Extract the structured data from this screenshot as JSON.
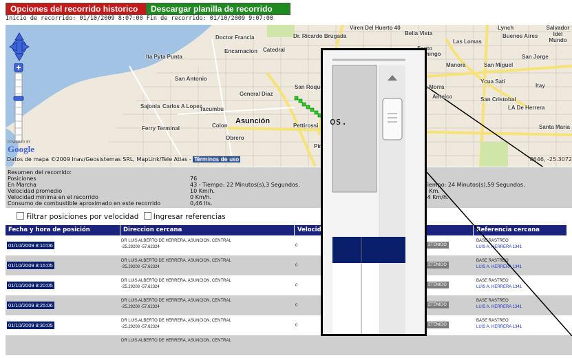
{
  "toolbar": {
    "history_options": "Opciones del recorrido historico",
    "download_sheet": "Descargar planilla de recorrido"
  },
  "period": "Inicio de recorrido: 01/10/2009 8:07:00 Fin de recorrido: 01/10/2009 9:07:00",
  "map": {
    "labels": [
      "Doctor Francia",
      "Dr. Ricardo Brugada",
      "Viren Del Huerto 40",
      "Bella Vista",
      "Lynch",
      "Salvador Idel Mundo",
      "Buenos Aires",
      "Las Lomas",
      "Encarnacion",
      "Catedral",
      "Ita Pyta Punta",
      "Manicoria",
      "Santo",
      "Domingo",
      "San Jorge",
      "Manora",
      "San Miguel",
      "San Antonio",
      "San Roque",
      "Ycua Sati",
      "Itay",
      "General Diaz",
      "lla Morra",
      "Antelco",
      "San Cristobal",
      "LA De Herrera",
      "Sajonia",
      "Carlos A Lopez",
      "Tacumbu",
      "Asunción",
      "Colon",
      "Pettirossi",
      "B. Ca",
      "Santa Maria",
      "Ferry Terminal",
      "Obrero",
      "Pin",
      "Mercado"
    ],
    "attribution": "Datos de mapa ©2009 Inav/Geosistemas SRL, MapLink/Tele Atlas -",
    "terms": "Términos de uso",
    "coord_readout": "8646, -25.3072",
    "google_powered": "POWERED BY",
    "google_logo": "Google"
  },
  "summary": {
    "heading": "Resumen del recorrido:",
    "rows": [
      {
        "label": "Posiciones",
        "value": "76",
        "value2": ""
      },
      {
        "label": "En Marcha",
        "value": "43 - Tiempo: 22 Minutos(s),3 Segundos.",
        "value2": "7 - Tiempo: 24 Minutos(s),59 Segundos."
      },
      {
        "label": "Velocidad promedio",
        "value": "10 Km/h.",
        "value2": "5,75 Km."
      },
      {
        "label": "Velocidad minima en el recorrido",
        "value": "0 Km/h.",
        "value2": "do 54 Km/h."
      },
      {
        "label": "Consumo de combustible aproximado en este recorrido",
        "value": "0,46 lts.",
        "value2": ""
      }
    ]
  },
  "filters": {
    "speed_filter": "Filtrar posiciones por velocidad",
    "references": "Ingresar referencias"
  },
  "table": {
    "columns": [
      "Fecha y hora de posición",
      "Direccion cercana",
      "Velocida",
      "",
      "Referencia cercana"
    ],
    "rows": [
      {
        "date": "01/10/2009 8:10:06",
        "addr1": "DR LUIS ALBERTO DE HERRERA, ASUNCION, CENTRAL",
        "addr2": "-25.29208 -57.62324",
        "speed": "0",
        "status": "ETENIDO",
        "ref1": "BASE RASTREO",
        "ref2": "LUIS A. HERRERA 1341"
      },
      {
        "date": "01/10/2009 8:15:05",
        "addr1": "DR LUIS ALBERTO DE HERRERA, ASUNCION, CENTRAL",
        "addr2": "-25.29208 -57.62324",
        "speed": "0",
        "status": "ETENIDO",
        "ref1": "BASE RASTREO",
        "ref2": "LUIS A. HERRERA 1341"
      },
      {
        "date": "01/10/2009 8:20:05",
        "addr1": "DR LUIS ALBERTO DE HERRERA, ASUNCION, CENTRAL",
        "addr2": "-25.29208 -57.62324",
        "speed": "0",
        "status": "ETENIDO",
        "ref1": "BASE RASTREO",
        "ref2": "LUIS A. HERRERA 1341"
      },
      {
        "date": "01/10/2009 8:25:06",
        "addr1": "DR LUIS ALBERTO DE HERRERA, ASUNCION, CENTRAL",
        "addr2": "-25.29208 -57.62324",
        "speed": "0",
        "status": "ETENIDO",
        "ref1": "BASE RASTREO",
        "ref2": "LUIS A. HERRERA 1341"
      },
      {
        "date": "01/10/2009 8:30:05",
        "addr1": "DR LUIS ALBERTO DE HERRERA, ASUNCION, CENTRAL",
        "addr2": "-25.29208 -57.62324",
        "speed": "0",
        "status": "ETENIDO",
        "ref1": "BASE RASTREO",
        "ref2": "LUIS A. HERRERA 1341"
      },
      {
        "date": "",
        "addr1": "DR LUIS ALBERTO DE HERRERA, ASUNCION, CENTRAL",
        "addr2": "",
        "speed": "",
        "status": "",
        "ref1": "",
        "ref2": ""
      }
    ]
  },
  "zoom_inset": {
    "text": "os."
  },
  "colors": {
    "history_btn": "#c41a1a",
    "download_btn": "#1f8a1f",
    "table_header": "#1a237e",
    "route_point": "#22cc22"
  }
}
